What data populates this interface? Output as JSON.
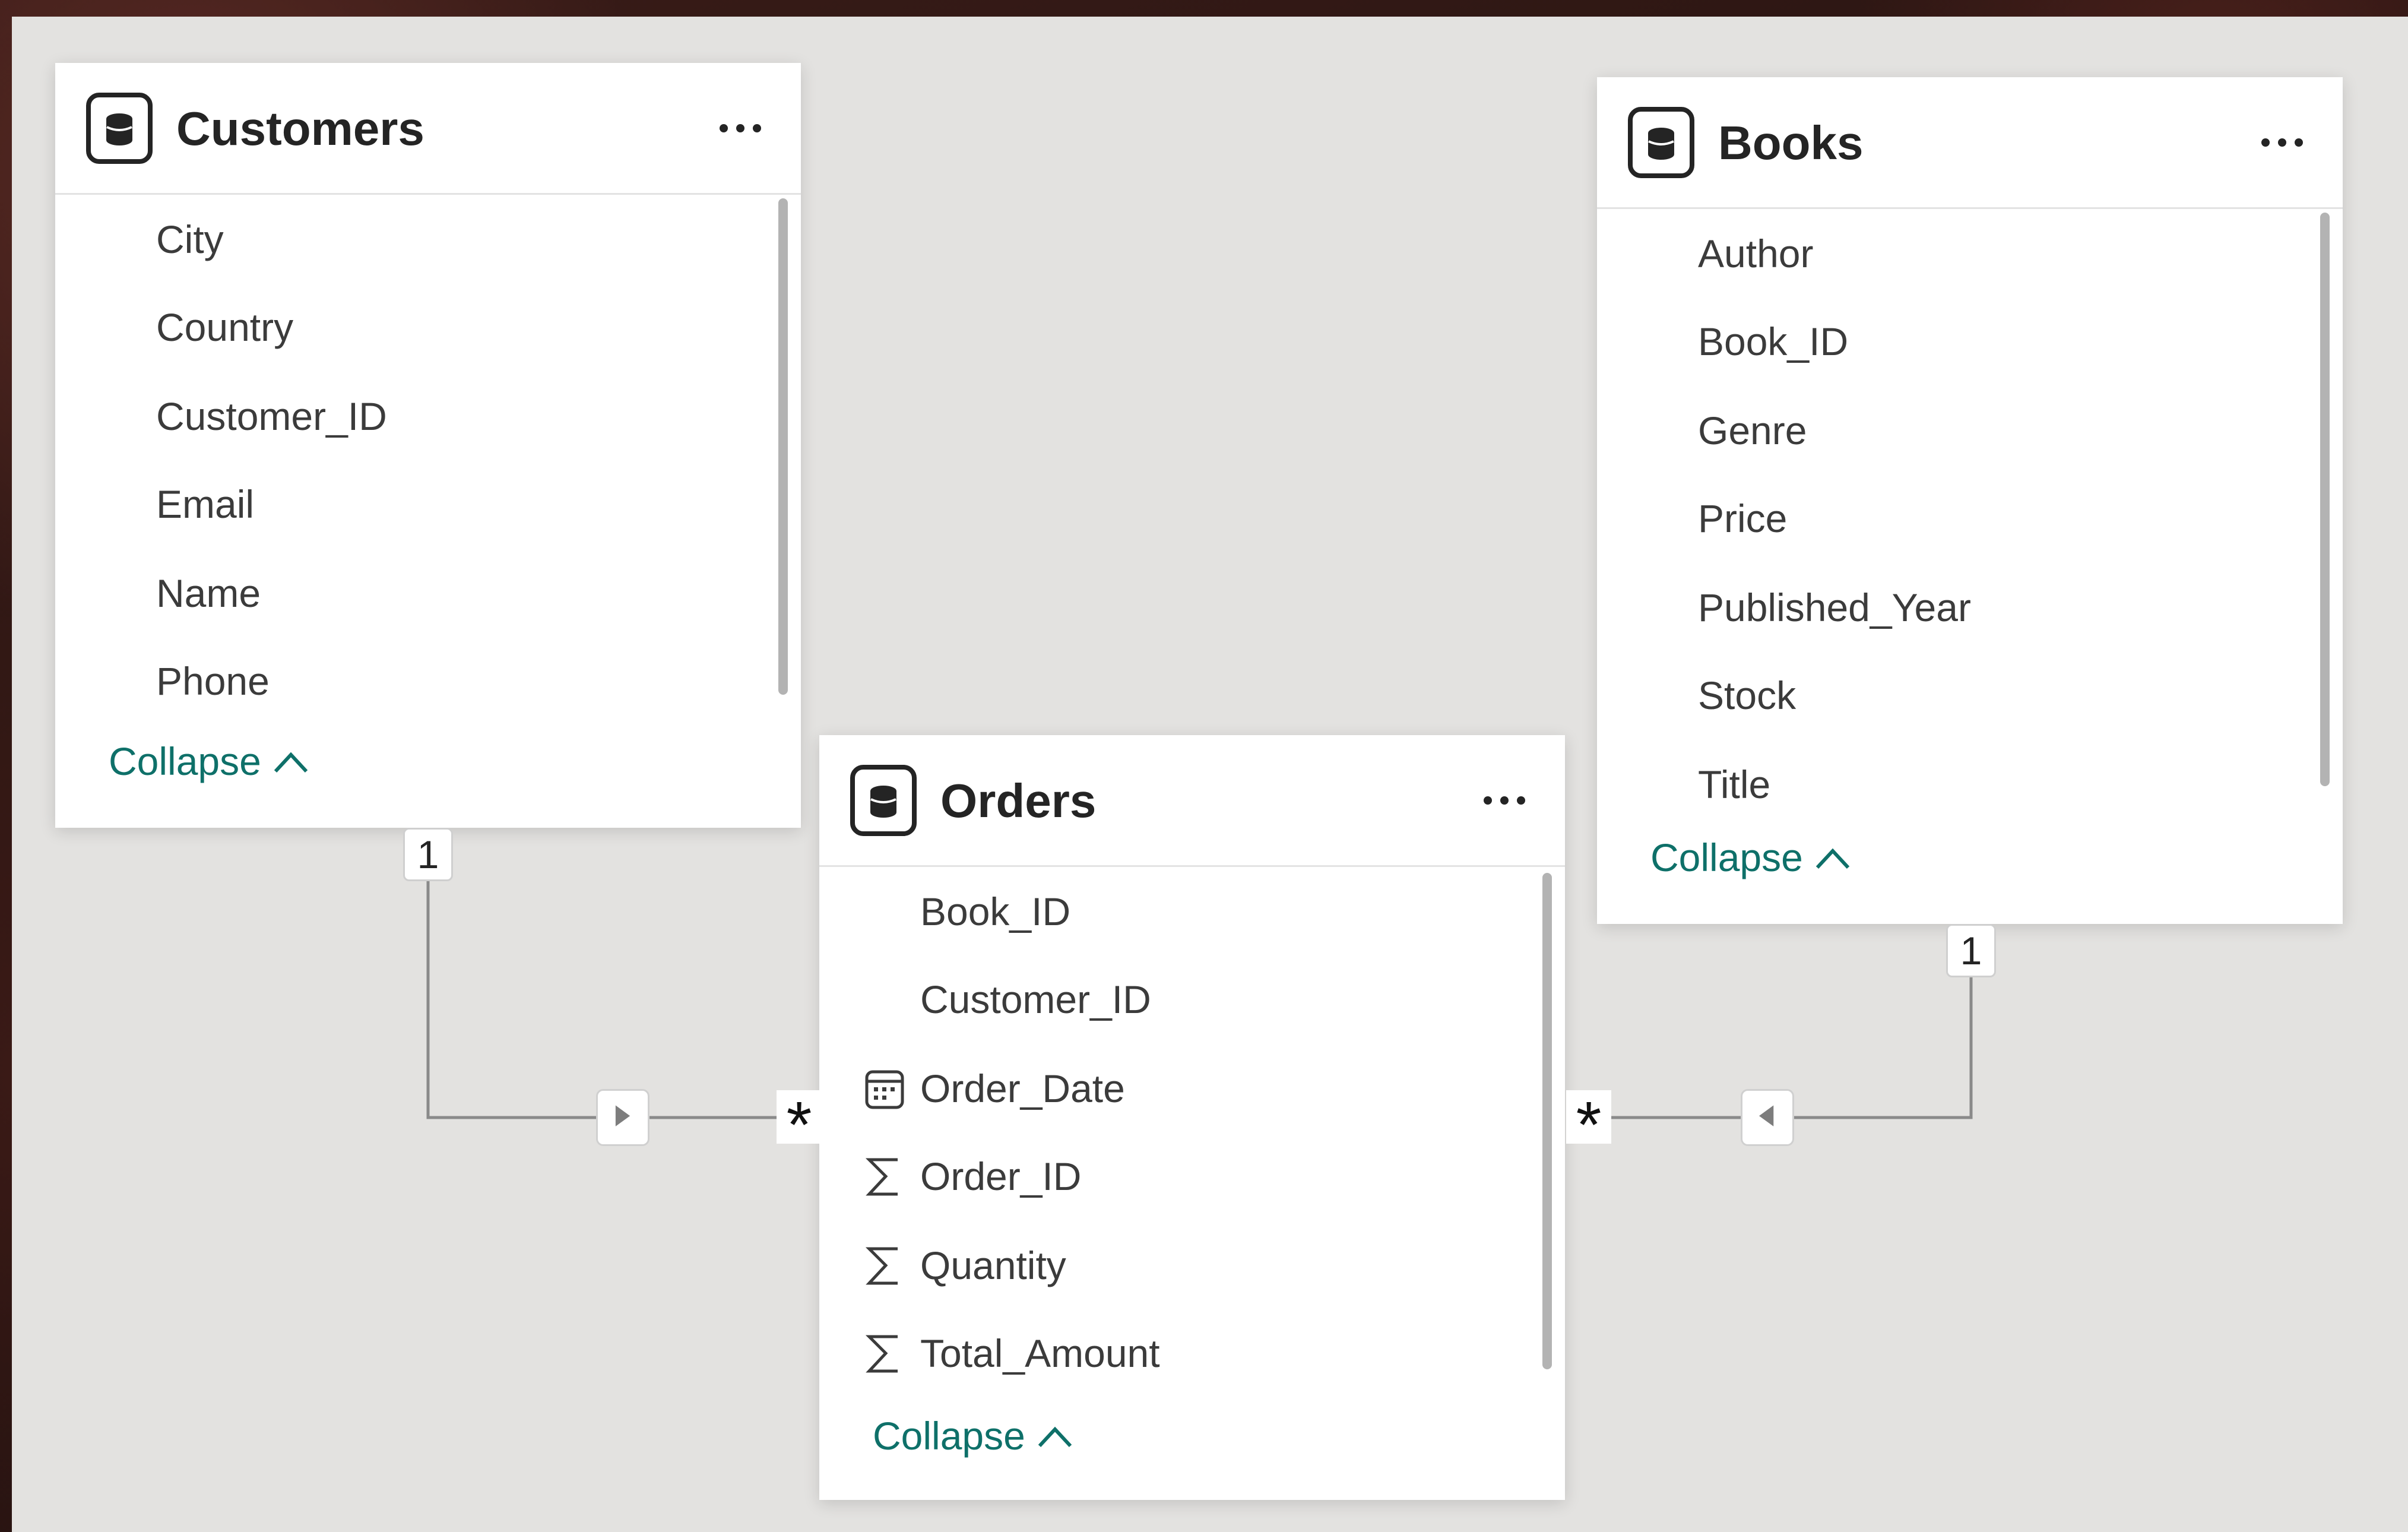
{
  "tables": [
    {
      "id": "customers",
      "title": "Customers",
      "more_label": "…",
      "fields": [
        {
          "name": "City",
          "icon": "none"
        },
        {
          "name": "Country",
          "icon": "none"
        },
        {
          "name": "Customer_ID",
          "icon": "none"
        },
        {
          "name": "Email",
          "icon": "none"
        },
        {
          "name": "Name",
          "icon": "none"
        },
        {
          "name": "Phone",
          "icon": "none"
        }
      ],
      "collapse_label": "Collapse"
    },
    {
      "id": "orders",
      "title": "Orders",
      "more_label": "…",
      "fields": [
        {
          "name": "Book_ID",
          "icon": "none"
        },
        {
          "name": "Customer_ID",
          "icon": "none"
        },
        {
          "name": "Order_Date",
          "icon": "calendar-icon"
        },
        {
          "name": "Order_ID",
          "icon": "sigma-icon"
        },
        {
          "name": "Quantity",
          "icon": "sigma-icon"
        },
        {
          "name": "Total_Amount",
          "icon": "sigma-icon"
        }
      ],
      "collapse_label": "Collapse"
    },
    {
      "id": "books",
      "title": "Books",
      "more_label": "…",
      "fields": [
        {
          "name": "Author",
          "icon": "none"
        },
        {
          "name": "Book_ID",
          "icon": "none"
        },
        {
          "name": "Genre",
          "icon": "none"
        },
        {
          "name": "Price",
          "icon": "none"
        },
        {
          "name": "Published_Year",
          "icon": "none"
        },
        {
          "name": "Stock",
          "icon": "none"
        },
        {
          "name": "Title",
          "icon": "none"
        }
      ],
      "collapse_label": "Collapse"
    }
  ],
  "relationships": [
    {
      "from": "Customers",
      "to": "Orders",
      "one_label": "1",
      "many_label": "*",
      "direction": "toward-orders"
    },
    {
      "from": "Books",
      "to": "Orders",
      "one_label": "1",
      "many_label": "*",
      "direction": "toward-orders"
    }
  ],
  "colors": {
    "canvas": "#e3e2e0",
    "card": "#ffffff",
    "text": "#3b3b3b",
    "title": "#242424",
    "collapse_link": "#0e7069",
    "connector": "#8a8a8a"
  }
}
